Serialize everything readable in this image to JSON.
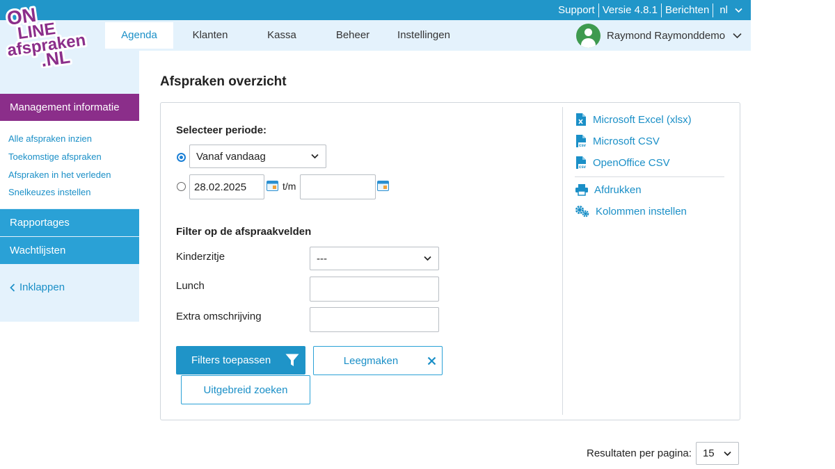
{
  "topbar": {
    "links": [
      "Support",
      "Versie 4.8.1",
      "Berichten"
    ],
    "language": "nl"
  },
  "logo": {
    "line1": "ON",
    "line2": "LINE",
    "line3": "afspraken",
    "line4": ".NL"
  },
  "nav": {
    "tabs": [
      "Agenda",
      "Klanten",
      "Kassa",
      "Beheer",
      "Instellingen"
    ],
    "active_tab": "Agenda",
    "user_name": "Raymond Raymonddemo"
  },
  "sidebar": {
    "header": "Management informatie",
    "sub_items": [
      "Alle afspraken inzien",
      "Toekomstige afspraken",
      "Afspraken in het verleden",
      "Snelkeuzes instellen"
    ],
    "sections": [
      "Rapportages",
      "Wachtlijsten"
    ],
    "collapse_label": "Inklappen"
  },
  "page": {
    "title": "Afspraken overzicht"
  },
  "period": {
    "heading": "Selecteer periode:",
    "preset_value": "Vanaf vandaag",
    "from_date": "28.02.2025",
    "to_label": "t/m",
    "to_date": ""
  },
  "filters": {
    "heading": "Filter op de afspraakvelden",
    "fields": [
      {
        "label": "Kinderzitje",
        "type": "select",
        "value": "---"
      },
      {
        "label": "Lunch",
        "type": "input",
        "value": ""
      },
      {
        "label": "Extra omschrijving",
        "type": "input",
        "value": ""
      }
    ],
    "apply_label": "Filters toepassen",
    "clear_label": "Leegmaken",
    "advanced_label": "Uitgebreid zoeken"
  },
  "export": {
    "items": [
      "Microsoft Excel (xlsx)",
      "Microsoft CSV",
      "OpenOffice CSV"
    ],
    "print_label": "Afdrukken",
    "columns_label": "Kolommen instellen"
  },
  "results": {
    "label": "Resultaten per pagina:",
    "value": "15"
  },
  "colors": {
    "topbar": "#2196c9",
    "nav_bg": "#e4f2fc",
    "sidebar_header": "#8b2e8a",
    "sidebar_section": "#2aa1d6",
    "link": "#1a8fc7",
    "button": "#1f94c8"
  }
}
